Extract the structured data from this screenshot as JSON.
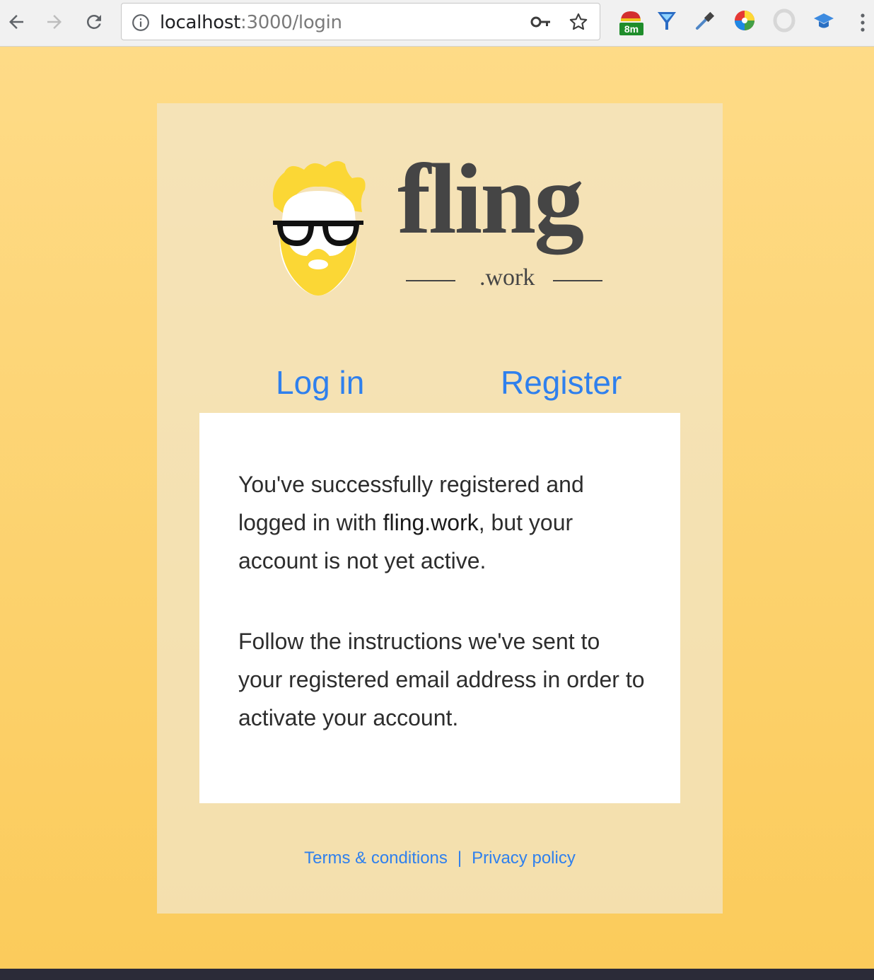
{
  "browser": {
    "url_host": "localhost",
    "url_rest": ":3000/login",
    "extension_badge": "8m"
  },
  "logo": {
    "word": "fling",
    "sub": ".work"
  },
  "tabs": {
    "login": "Log in",
    "register": "Register"
  },
  "message": {
    "p1_before": "You've successfully registered and logged in with ",
    "p1_brand": "fling.work",
    "p1_after": ", but your account is not yet active.",
    "p2": "Follow the instructions we've sent to your registered email address in order to activate your account."
  },
  "footer": {
    "terms": "Terms & conditions",
    "separator": "|",
    "privacy": "Privacy policy"
  },
  "colors": {
    "accent": "#2f80ed",
    "background_top": "#fedb87",
    "background_bottom": "#fbcb5b",
    "text": "#2d2d2d"
  }
}
